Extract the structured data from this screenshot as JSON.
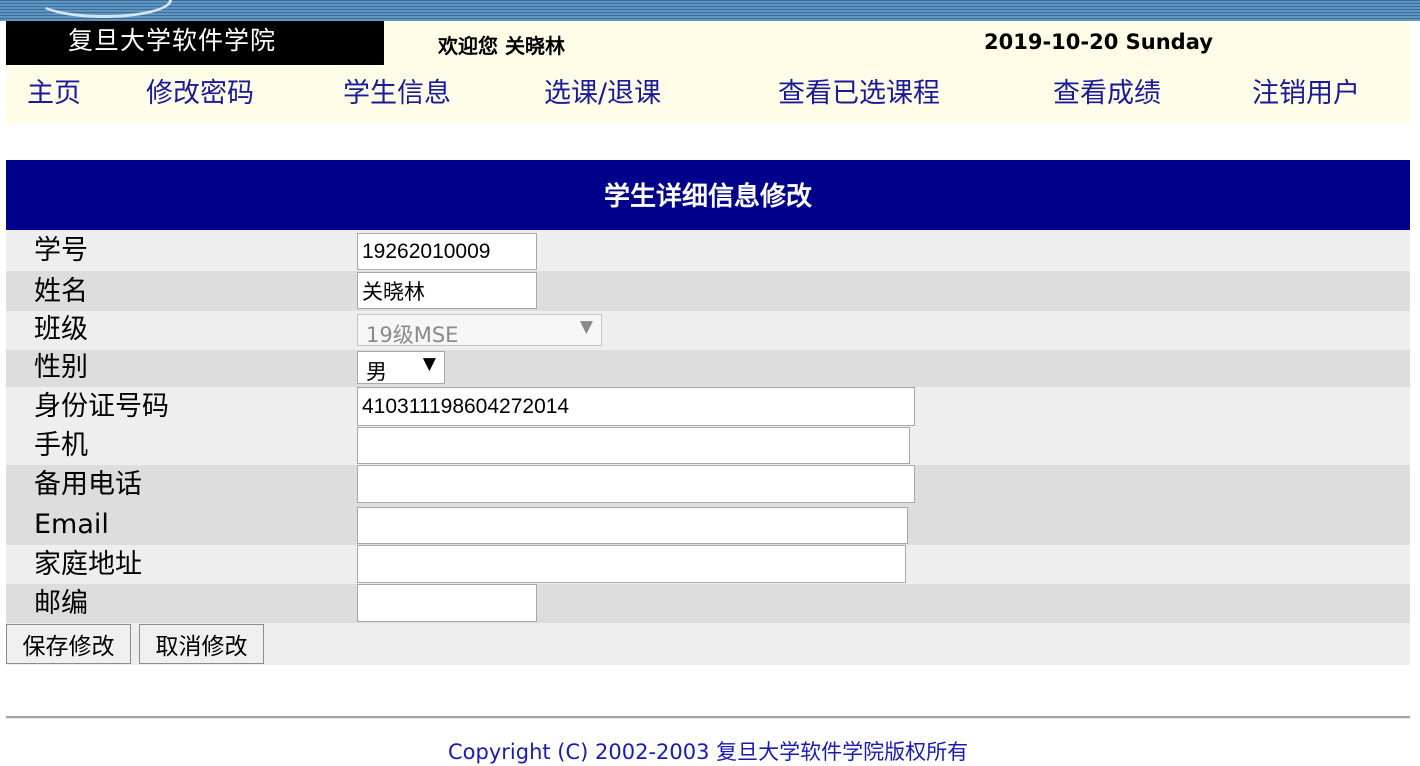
{
  "header": {
    "logo_text": "复旦大学软件学院",
    "welcome": "欢迎您 关晓林",
    "date": "2019-10-20 Sunday"
  },
  "nav": {
    "items": [
      "主页",
      "修改密码",
      "学生信息",
      "选课/退课",
      "查看已选课程",
      "查看成绩",
      "注销用户"
    ]
  },
  "form": {
    "title": "学生详细信息修改",
    "fields": [
      {
        "label": "学号",
        "value": "19262010009"
      },
      {
        "label": "姓名",
        "value": "关晓林"
      },
      {
        "label": "班级",
        "value": "19级MSE"
      },
      {
        "label": "性别",
        "value": "男"
      },
      {
        "label": "身份证号码",
        "value": "410311198604272014"
      },
      {
        "label": "手机",
        "value": ""
      },
      {
        "label": "备用电话",
        "value": ""
      },
      {
        "label": "Email",
        "value": ""
      },
      {
        "label": "家庭地址",
        "value": ""
      },
      {
        "label": "邮编",
        "value": ""
      }
    ],
    "save_label": "保存修改",
    "cancel_label": "取消修改"
  },
  "footer": {
    "copyright": "Copyright (C) 2002-2003 复旦大学软件学院版权所有"
  },
  "colors": {
    "title_bar": "#00008b",
    "header_bg": "#fffde8",
    "nav_link": "#1a1a9a",
    "footer_link": "#1a1ab4",
    "row_light": "#eeeeee",
    "row_dark": "#dddddd"
  }
}
